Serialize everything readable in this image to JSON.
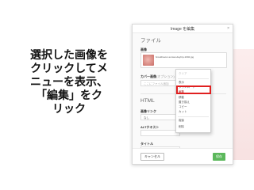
{
  "instruction": {
    "lines": [
      "選択した画像を",
      "クリックしてメ",
      "ニューを表示、",
      "「編集」をク",
      "リック"
    ]
  },
  "dialog": {
    "title": "Image を編集",
    "close_label": "×",
    "file_section": "ファイル",
    "image_label": "画像",
    "file_name": "brookhaven-sunset-daytrip-1002.jpg",
    "cover_label": "カバー画像",
    "cover_hint": "(オプション)",
    "cover_placeholder": "ここにファイル追加",
    "html_section": "HTML",
    "link_label": "画像リンク",
    "link_value": "なし",
    "alt_label": "ALTテキスト",
    "title_label": "タイトル",
    "cancel_label": "キャンセル",
    "save_label": "保存"
  },
  "context_menu": {
    "items": [
      {
        "label": "クリア",
        "state": "dim"
      },
      {
        "label": "表示",
        "state": "normal"
      },
      {
        "label": "ダウンロード",
        "state": "normal"
      },
      {
        "label": "編集",
        "state": "highlighted"
      },
      {
        "label": "移動",
        "state": "normal"
      },
      {
        "label": "置き換え",
        "state": "normal"
      },
      {
        "label": "コピー",
        "state": "normal"
      },
      {
        "label": "カット",
        "state": "normal"
      },
      {
        "label": "複製",
        "state": "normal"
      },
      {
        "label": "削除",
        "state": "normal"
      }
    ]
  },
  "colors": {
    "highlight_border": "#e02020",
    "save_button": "#5cb85c"
  }
}
